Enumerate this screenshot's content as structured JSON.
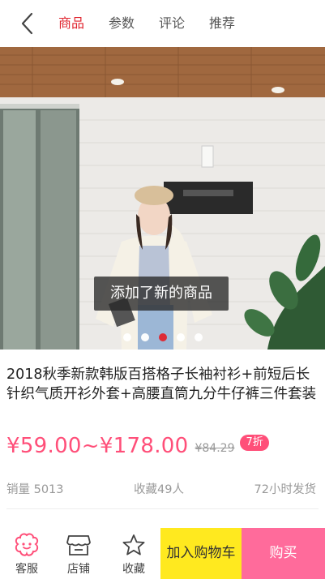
{
  "header": {
    "back_icon": "chevron-left-icon",
    "tabs": [
      {
        "label": "商品",
        "active": true
      },
      {
        "label": "参数",
        "active": false
      },
      {
        "label": "评论",
        "active": false
      },
      {
        "label": "推荐",
        "active": false
      }
    ]
  },
  "gallery": {
    "toast": "添加了新的商品",
    "slide_count": 5,
    "active_slide": 3
  },
  "product": {
    "title": "2018秋季新款韩版百搭格子长袖衬衫+前短后长针织气质开衫外套+高腰直筒九分牛仔裤三件套装",
    "price_range": "¥59.00~¥178.00",
    "original_price": "¥84.29",
    "discount": "7折",
    "sales": "销量 5013",
    "favorites": "收藏49人",
    "shipping": "72小时发货"
  },
  "bottom_bar": {
    "service": {
      "label": "客服",
      "icon": "customer-service-icon"
    },
    "store": {
      "label": "店铺",
      "icon": "store-icon"
    },
    "favorite": {
      "label": "收藏",
      "icon": "star-icon"
    },
    "add_to_cart": "加入购物车",
    "buy": "购买"
  },
  "colors": {
    "accent_red": "#e0232d",
    "price_pink": "#ff4f79",
    "cart_yellow": "#ffe91f",
    "buy_pink": "#ff6b9b"
  }
}
